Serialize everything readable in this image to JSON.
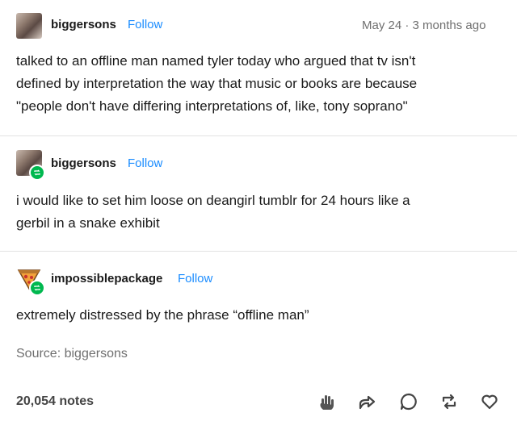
{
  "posts": [
    {
      "username": "biggersons",
      "follow_label": "Follow",
      "date": "May 24",
      "separator": "·",
      "ago": "3 months ago",
      "lines": [
        "talked to an offline man named tyler today who argued that tv isn't",
        "defined by interpretation the way that music or books are because",
        "\"people don't have differing interpretations of, like, tony soprano\""
      ]
    },
    {
      "username": "biggersons",
      "follow_label": "Follow",
      "lines": [
        "i would like to set him loose on deangirl tumblr for 24 hours like a",
        "gerbil in a snake exhibit"
      ]
    },
    {
      "username": "impossiblepackage",
      "follow_label": "Follow",
      "lines": [
        "extremely distressed by the phrase “offline man”"
      ]
    }
  ],
  "source_text": "Source: biggersons",
  "notes_count": "20,054 notes",
  "actions": [
    "blaze-icon",
    "share-icon",
    "reply-icon",
    "reblog-icon",
    "like-icon"
  ],
  "colors": {
    "follow": "#1a8cff",
    "reblog_badge": "#00b84f",
    "muted": "#6f6f6f"
  }
}
